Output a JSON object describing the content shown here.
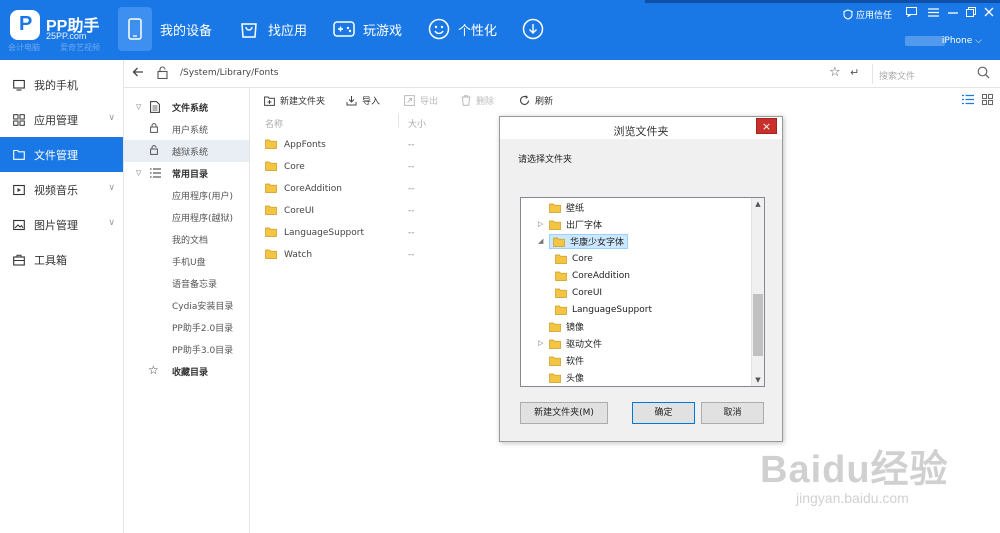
{
  "app": {
    "logo_letter": "P",
    "title": "PP助手",
    "subtitle": "25PP.com",
    "bg_labels": [
      "会计电脑",
      "爱奇艺视频",
      "WPS文字"
    ]
  },
  "nav": {
    "my_device": "我的设备",
    "find_apps": "找应用",
    "games": "玩游戏",
    "personalize": "个性化"
  },
  "top_right": {
    "app_trust": "应用信任",
    "device_name": "iPhone"
  },
  "sidebar": {
    "items": [
      {
        "label": "我的手机"
      },
      {
        "label": "应用管理"
      },
      {
        "label": "文件管理"
      },
      {
        "label": "视频音乐"
      },
      {
        "label": "图片管理"
      },
      {
        "label": "工具箱"
      }
    ]
  },
  "path": {
    "current": "/System/Library/Fonts",
    "search_placeholder": "搜索文件"
  },
  "tree": {
    "file_system": "文件系统",
    "user_system": "用户系统",
    "jailbreak_system": "越狱系统",
    "common_dirs": "常用目录",
    "app_user": "应用程序(用户)",
    "app_jailbreak": "应用程序(越狱)",
    "my_docs": "我的文档",
    "phone_udisk": "手机U盘",
    "voice_memo": "语音备忘录",
    "cydia": "Cydia安装目录",
    "pp2": "PP助手2.0目录",
    "pp3": "PP助手3.0目录",
    "favorites": "收藏目录"
  },
  "toolbar": {
    "new_folder": "新建文件夹",
    "import": "导入",
    "export": "导出",
    "delete": "删除",
    "refresh": "刷新"
  },
  "list": {
    "col_name": "名称",
    "col_size": "大小",
    "files": [
      {
        "name": "AppFonts",
        "size": "--"
      },
      {
        "name": "Core",
        "size": "--"
      },
      {
        "name": "CoreAddition",
        "size": "--"
      },
      {
        "name": "CoreUI",
        "size": "--"
      },
      {
        "name": "LanguageSupport",
        "size": "--"
      },
      {
        "name": "Watch",
        "size": "--"
      }
    ]
  },
  "dialog": {
    "title": "浏览文件夹",
    "close": "×",
    "prompt": "请选择文件夹",
    "folders": [
      {
        "label": "壁纸"
      },
      {
        "label": "出厂字体"
      },
      {
        "label": "华康少女字体"
      },
      {
        "label": "Core"
      },
      {
        "label": "CoreAddition"
      },
      {
        "label": "CoreUI"
      },
      {
        "label": "LanguageSupport"
      },
      {
        "label": "镜像"
      },
      {
        "label": "驱动文件"
      },
      {
        "label": "软件"
      },
      {
        "label": "头像"
      }
    ],
    "new_folder_btn": "新建文件夹(M)",
    "ok_btn": "确定",
    "cancel_btn": "取消"
  },
  "watermark": {
    "brand": "Baidu经验",
    "url": "jingyan.baidu.com"
  },
  "colors": {
    "brand_blue": "#1a78e6",
    "folder_yellow": "#f4c542",
    "close_red": "#c9302c"
  }
}
